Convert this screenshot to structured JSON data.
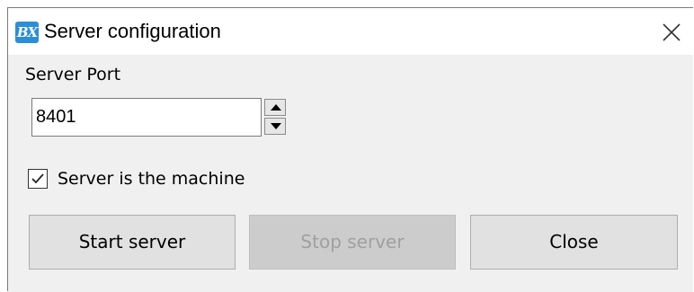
{
  "window": {
    "app_icon_text": "BX",
    "title": "Server configuration",
    "close_icon": "close-icon"
  },
  "form": {
    "port_label": "Server Port",
    "port_value": "8401",
    "spinner_up_icon": "arrow-up-icon",
    "spinner_down_icon": "arrow-down-icon",
    "checkbox_checked": true,
    "checkbox_label": "Server is the machine"
  },
  "buttons": {
    "start_label": "Start server",
    "stop_label": "Stop server",
    "stop_enabled": false,
    "close_label": "Close"
  },
  "colors": {
    "app_icon_bg": "#2a8fd8",
    "disabled_text": "#a0a0a0"
  }
}
